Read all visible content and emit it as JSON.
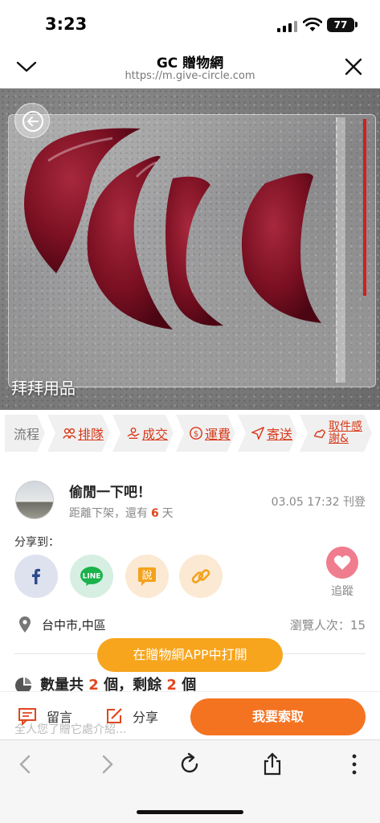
{
  "status_bar": {
    "time": "3:23",
    "battery": "77"
  },
  "browser": {
    "title": "GC 贈物網",
    "url": "https://m.give-circle.com"
  },
  "photo": {
    "caption": "拜拜用品"
  },
  "flow_steps": [
    {
      "label": "流程",
      "icon": "none"
    },
    {
      "label": "排隊",
      "icon": "people-icon"
    },
    {
      "label": "成交",
      "icon": "handshake-icon"
    },
    {
      "label": "運費",
      "icon": "dollar-icon"
    },
    {
      "label": "寄送",
      "icon": "send-icon"
    },
    {
      "label": "取件感謝&",
      "icon": "thanks-icon"
    }
  ],
  "poster": {
    "name": "偷閒一下吧！",
    "remain_prefix": "距離下架，還有",
    "remain_days": "6",
    "remain_suffix": "天",
    "posted": "03.05 17:32 刊登"
  },
  "share": {
    "label": "分享到：",
    "talk_glyph": "說",
    "line_text": "LINE",
    "track_label": "追蹤"
  },
  "location": {
    "city": "台中市,中區",
    "views": "瀏覽人次：15"
  },
  "open_app": "在贈物網APP中打開",
  "quantity": {
    "prefix": "數量共",
    "total": "2",
    "mid": "個，剩餘",
    "left": "2",
    "suffix": "個"
  },
  "actions": {
    "message": "留言",
    "share": "分享",
    "claim": "我要索取",
    "ghost_text": "全人您了贈它處介紹..."
  },
  "colors": {
    "accent": "#f47321",
    "open_app": "#f7a51d",
    "highlight": "#e0461e",
    "heart": "#ef7d8e"
  }
}
